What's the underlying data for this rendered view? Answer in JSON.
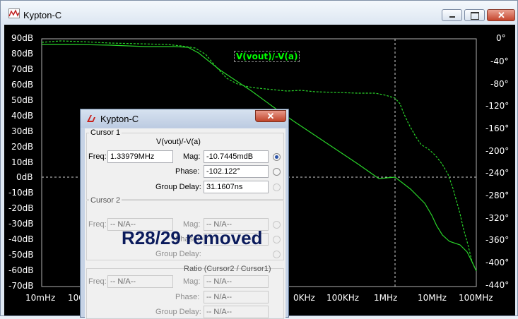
{
  "window": {
    "title": "Kypton-C"
  },
  "plot": {
    "trace_title": "V(vout)/-V(a)",
    "left_axis": [
      "90dB",
      "80dB",
      "70dB",
      "60dB",
      "50dB",
      "40dB",
      "30dB",
      "20dB",
      "10dB",
      "0dB",
      "-10dB",
      "-20dB",
      "-30dB",
      "-40dB",
      "-50dB",
      "-60dB",
      "-70dB"
    ],
    "right_axis": [
      "0°",
      "-40°",
      "-80°",
      "-120°",
      "-160°",
      "-200°",
      "-240°",
      "-280°",
      "-320°",
      "-360°",
      "-400°",
      "-440°"
    ],
    "x_axis": [
      "10mHz",
      "100",
      "0KHz",
      "100KHz",
      "1MHz",
      "10MHz",
      "100MHz"
    ],
    "colors": {
      "background": "#000000",
      "trace": "#00ff00"
    }
  },
  "dialog": {
    "title": "Kypton-C",
    "close_glyph": "✕",
    "cursor1": {
      "group_label": "Cursor 1",
      "expression": "V(vout)/-V(a)",
      "freq_label": "Freq:",
      "freq_value": "1.33979MHz",
      "mag_label": "Mag:",
      "mag_value": "-10.7445mdB",
      "phase_label": "Phase:",
      "phase_value": "-102.122°",
      "group_delay_label": "Group Delay:",
      "group_delay_value": "31.1607ns"
    },
    "cursor2": {
      "group_label": "Cursor 2",
      "freq_label": "Freq:",
      "freq_value": "-- N/A--",
      "mag_label": "Mag:",
      "mag_value": "-- N/A--",
      "phase_label": "Phase:",
      "group_delay_label": "Group Delay:"
    },
    "ratio": {
      "group_label": "Ratio (Cursor2 / Cursor1)",
      "freq_label": "Freq:",
      "freq_value": "-- N/A--",
      "mag_label": "Mag:",
      "mag_value": "-- N/A--",
      "phase_label": "Phase:",
      "phase_value": "-- N/A--",
      "group_delay_label": "Group Delay:",
      "group_delay_value": "-- N/A--"
    }
  },
  "overlay_text": "R28/29 removed"
}
